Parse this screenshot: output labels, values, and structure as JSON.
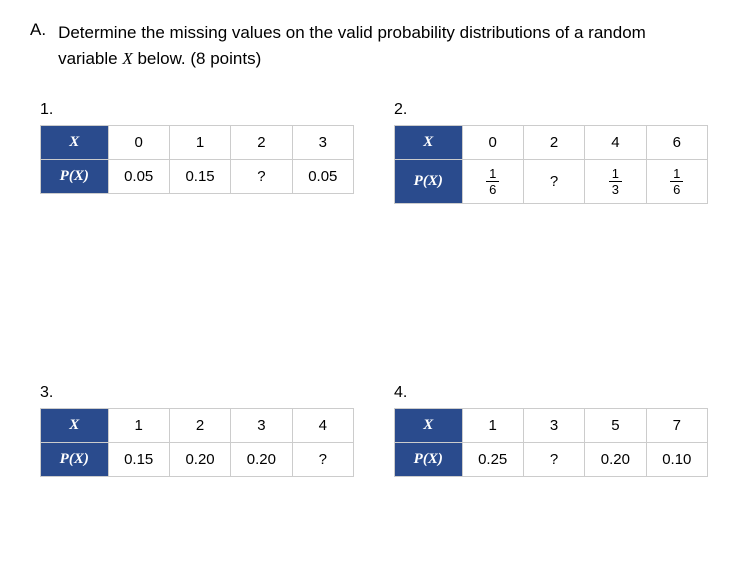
{
  "question": {
    "letter": "A.",
    "text_part1": "Determine the missing values on the valid probability distributions of a random variable ",
    "variable": "X",
    "text_part2": " below. (8 points)"
  },
  "tables": [
    {
      "num": "1.",
      "row_labels": [
        "X",
        "P(X)"
      ],
      "x": [
        "0",
        "1",
        "2",
        "3"
      ],
      "p": [
        "0.05",
        "0.15",
        "?",
        "0.05"
      ]
    },
    {
      "num": "2.",
      "row_labels": [
        "X",
        "P(X)"
      ],
      "x": [
        "0",
        "2",
        "4",
        "6"
      ],
      "p_frac": [
        {
          "n": "1",
          "d": "6"
        },
        null,
        {
          "n": "1",
          "d": "3"
        },
        {
          "n": "1",
          "d": "6"
        }
      ],
      "p_plain": [
        null,
        "?",
        null,
        null
      ]
    },
    {
      "num": "3.",
      "row_labels": [
        "X",
        "P(X)"
      ],
      "x": [
        "1",
        "2",
        "3",
        "4"
      ],
      "p": [
        "0.15",
        "0.20",
        "0.20",
        "?"
      ]
    },
    {
      "num": "4.",
      "row_labels": [
        "X",
        "P(X)"
      ],
      "x": [
        "1",
        "3",
        "5",
        "7"
      ],
      "p": [
        "0.25",
        "?",
        "0.20",
        "0.10"
      ]
    }
  ],
  "chart_data": [
    {
      "type": "table",
      "title": "Probability distribution 1",
      "columns": [
        "X",
        "P(X)"
      ],
      "rows": [
        [
          "0",
          "0.05"
        ],
        [
          "1",
          "0.15"
        ],
        [
          "2",
          "?"
        ],
        [
          "3",
          "0.05"
        ]
      ]
    },
    {
      "type": "table",
      "title": "Probability distribution 2",
      "columns": [
        "X",
        "P(X)"
      ],
      "rows": [
        [
          "0",
          "1/6"
        ],
        [
          "2",
          "?"
        ],
        [
          "4",
          "1/3"
        ],
        [
          "6",
          "1/6"
        ]
      ]
    },
    {
      "type": "table",
      "title": "Probability distribution 3",
      "columns": [
        "X",
        "P(X)"
      ],
      "rows": [
        [
          "1",
          "0.15"
        ],
        [
          "2",
          "0.20"
        ],
        [
          "3",
          "0.20"
        ],
        [
          "4",
          "?"
        ]
      ]
    },
    {
      "type": "table",
      "title": "Probability distribution 4",
      "columns": [
        "X",
        "P(X)"
      ],
      "rows": [
        [
          "1",
          "0.25"
        ],
        [
          "3",
          "?"
        ],
        [
          "5",
          "0.20"
        ],
        [
          "7",
          "0.10"
        ]
      ]
    }
  ]
}
